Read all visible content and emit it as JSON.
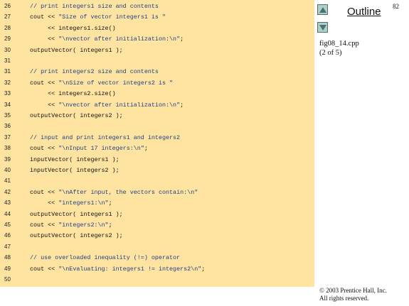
{
  "code": {
    "lines": [
      {
        "num": "26",
        "segments": [
          {
            "t": "// print integers1 size and contents",
            "c": "cmt"
          }
        ]
      },
      {
        "num": "27",
        "segments": [
          {
            "t": "cout << ",
            "c": "kw"
          },
          {
            "t": "\"Size of vector integers1 is \"",
            "c": "str"
          }
        ]
      },
      {
        "num": "28",
        "segments": [
          {
            "t": "     << integers1.size()",
            "c": "kw"
          }
        ]
      },
      {
        "num": "29",
        "segments": [
          {
            "t": "     << ",
            "c": "kw"
          },
          {
            "t": "\"\\nvector after initialization:\\n\"",
            "c": "str"
          },
          {
            "t": ";",
            "c": "kw"
          }
        ]
      },
      {
        "num": "30",
        "segments": [
          {
            "t": "outputVector( integers1 );",
            "c": "kw"
          }
        ]
      },
      {
        "num": "31",
        "segments": [
          {
            "t": "",
            "c": "kw"
          }
        ]
      },
      {
        "num": "31",
        "segments": [
          {
            "t": "// print integers2 size and contents",
            "c": "cmt"
          }
        ]
      },
      {
        "num": "32",
        "segments": [
          {
            "t": "cout << ",
            "c": "kw"
          },
          {
            "t": "\"\\nSize of vector integers2 is \"",
            "c": "str"
          }
        ]
      },
      {
        "num": "33",
        "segments": [
          {
            "t": "     << integers2.size()",
            "c": "kw"
          }
        ]
      },
      {
        "num": "34",
        "segments": [
          {
            "t": "     << ",
            "c": "kw"
          },
          {
            "t": "\"\\nvector after initialization:\\n\"",
            "c": "str"
          },
          {
            "t": ";",
            "c": "kw"
          }
        ]
      },
      {
        "num": "35",
        "segments": [
          {
            "t": "outputVector( integers2 );",
            "c": "kw"
          }
        ]
      },
      {
        "num": "36",
        "segments": [
          {
            "t": "",
            "c": "kw"
          }
        ]
      },
      {
        "num": "37",
        "segments": [
          {
            "t": "// input and print integers1 and integers2",
            "c": "cmt"
          }
        ]
      },
      {
        "num": "38",
        "segments": [
          {
            "t": "cout << ",
            "c": "kw"
          },
          {
            "t": "\"\\nInput 17 integers:\\n\"",
            "c": "str"
          },
          {
            "t": ";",
            "c": "kw"
          }
        ]
      },
      {
        "num": "39",
        "segments": [
          {
            "t": "inputVector( integers1 );",
            "c": "kw"
          }
        ]
      },
      {
        "num": "40",
        "segments": [
          {
            "t": "inputVector( integers2 );",
            "c": "kw"
          }
        ]
      },
      {
        "num": "41",
        "segments": [
          {
            "t": "",
            "c": "kw"
          }
        ]
      },
      {
        "num": "42",
        "segments": [
          {
            "t": "cout << ",
            "c": "kw"
          },
          {
            "t": "\"\\nAfter input, the vectors contain:\\n\"",
            "c": "str"
          }
        ]
      },
      {
        "num": "43",
        "segments": [
          {
            "t": "     << ",
            "c": "kw"
          },
          {
            "t": "\"integers1:\\n\"",
            "c": "str"
          },
          {
            "t": ";",
            "c": "kw"
          }
        ]
      },
      {
        "num": "44",
        "segments": [
          {
            "t": "outputVector( integers1 );",
            "c": "kw"
          }
        ]
      },
      {
        "num": "45",
        "segments": [
          {
            "t": "cout << ",
            "c": "kw"
          },
          {
            "t": "\"integers2:\\n\"",
            "c": "str"
          },
          {
            "t": ";",
            "c": "kw"
          }
        ]
      },
      {
        "num": "46",
        "segments": [
          {
            "t": "outputVector( integers2 );",
            "c": "kw"
          }
        ]
      },
      {
        "num": "47",
        "segments": [
          {
            "t": "",
            "c": "kw"
          }
        ]
      },
      {
        "num": "48",
        "segments": [
          {
            "t": "// use overloaded inequality (!=) operator",
            "c": "cmt"
          }
        ]
      },
      {
        "num": "49",
        "segments": [
          {
            "t": "cout << ",
            "c": "kw"
          },
          {
            "t": "\"\\nEvaluating: integers1 != integers2\\n\"",
            "c": "str"
          },
          {
            "t": ";",
            "c": "kw"
          }
        ]
      },
      {
        "num": "50",
        "segments": [
          {
            "t": "",
            "c": "kw"
          }
        ]
      }
    ]
  },
  "sidebar": {
    "outline_label": "Outline",
    "page_number": "82",
    "file_name": "fig08_14.cpp",
    "page_of": "(2 of 5)",
    "up_icon": "triangle-up-icon",
    "down_icon": "triangle-down-icon"
  },
  "footer": {
    "copyright_line1": "© 2003 Prentice Hall, Inc.",
    "copyright_line2": "All rights reserved."
  },
  "colors": {
    "code_background": "#ffe3a1",
    "string_color": "#1f3f86",
    "nav_button": "#a9d2cd"
  }
}
